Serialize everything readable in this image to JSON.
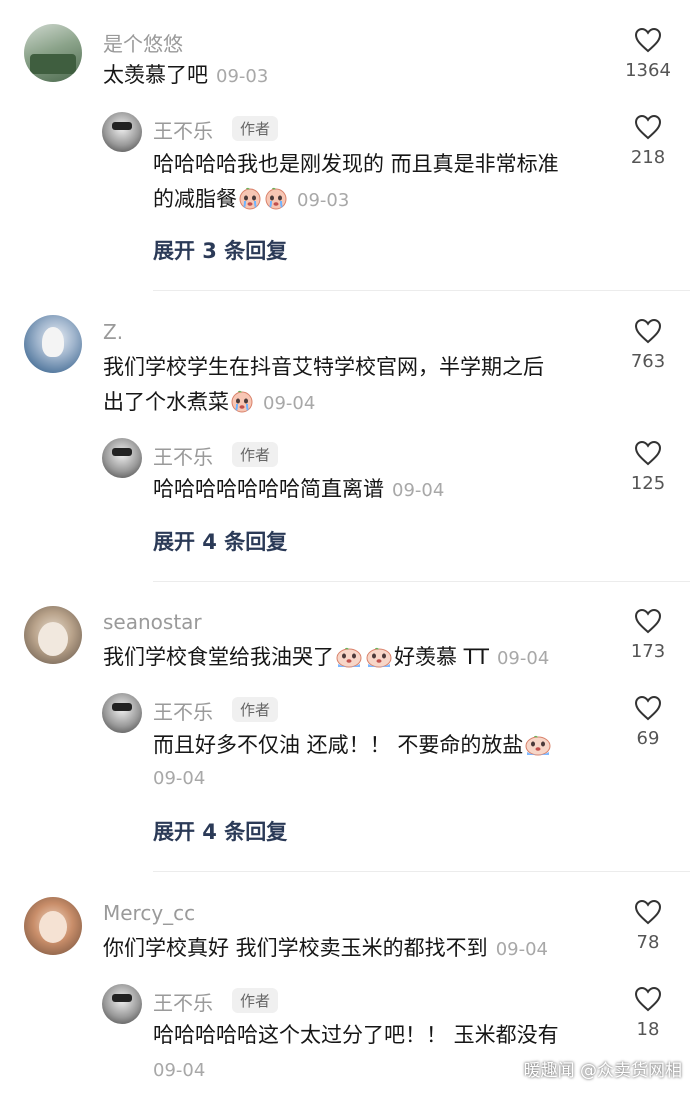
{
  "comments": [
    {
      "user": "是个悠悠",
      "text": "太羡慕了吧",
      "date": "09-03",
      "likes": "1364",
      "reply": {
        "user": "王不乐",
        "tag": "作者",
        "line1": "哈哈哈哈我也是刚发现的 而且真是非常标准",
        "line2": "的减脂餐",
        "date": "09-03",
        "likes": "218"
      },
      "expand": "展开 3 条回复"
    },
    {
      "user": "Z.",
      "line1": "我们学校学生在抖音艾特学校官网，半学期之后",
      "line2": "出了个水煮菜",
      "date": "09-04",
      "likes": "763",
      "reply": {
        "user": "王不乐",
        "tag": "作者",
        "text": "哈哈哈哈哈哈哈简直离谱",
        "date": "09-04",
        "likes": "125"
      },
      "expand": "展开 4 条回复"
    },
    {
      "user": "seanostar",
      "text_a": "我们学校食堂给我油哭了",
      "text_b": "好羡慕 TT",
      "date": "09-04",
      "likes": "173",
      "reply": {
        "user": "王不乐",
        "tag": "作者",
        "text": "而且好多不仅油 还咸！！ 不要命的放盐",
        "date": "09-04",
        "likes": "69"
      },
      "expand": "展开 4 条回复"
    },
    {
      "user": "Mercy_cc",
      "text": "你们学校真好 我们学校卖玉米的都找不到",
      "date": "09-04",
      "likes": "78",
      "reply": {
        "user": "王不乐",
        "tag": "作者",
        "text": "哈哈哈哈哈这个太过分了吧！！ 玉米都没有",
        "date": "09-04",
        "likes": "18"
      }
    }
  ],
  "watermark": "暖趣闻 @众卖货网相",
  "icons": {
    "like": "heart-outline-icon",
    "emoji": "crying-face-emoji"
  },
  "colors": {
    "expand": "#2b3a57",
    "muted": "#9a9a9a"
  }
}
